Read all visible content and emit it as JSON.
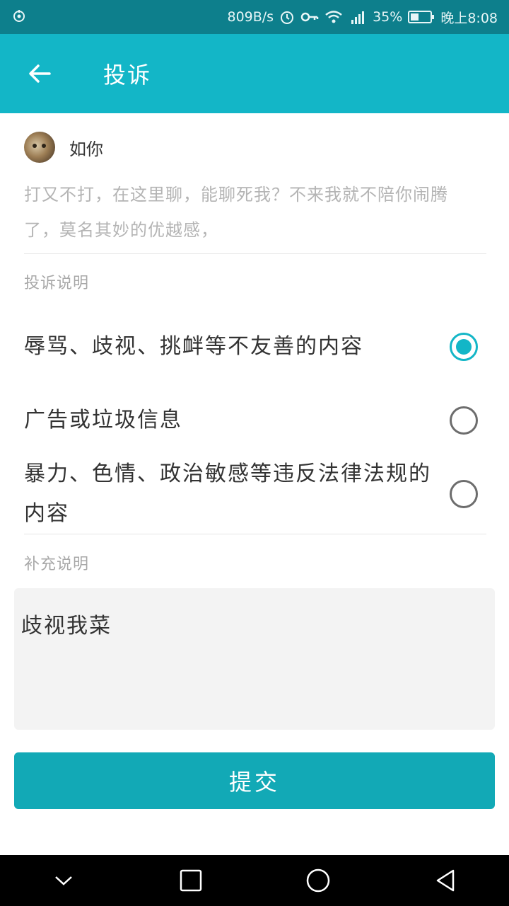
{
  "status_bar": {
    "speed": "809B/s",
    "battery": "35%",
    "time": "晚上8:08"
  },
  "app_bar": {
    "title": "投诉"
  },
  "post": {
    "username": "如你",
    "message": "打又不打，在这里聊，能聊死我？不来我就不陪你闹腾了，莫名其妙的优越感，"
  },
  "complaint": {
    "section_label": "投诉说明",
    "options": [
      {
        "label": "辱骂、歧视、挑衅等不友善的内容",
        "selected": true
      },
      {
        "label": "广告或垃圾信息",
        "selected": false
      },
      {
        "label": "暴力、色情、政治敏感等违反法律法规的内容",
        "selected": false
      }
    ]
  },
  "supplement": {
    "section_label": "补充说明",
    "value": "歧视我菜"
  },
  "submit_label": "提交",
  "colors": {
    "accent": "#13b6c7",
    "status_bar": "#0d7f8c",
    "button": "#12a9b6"
  }
}
